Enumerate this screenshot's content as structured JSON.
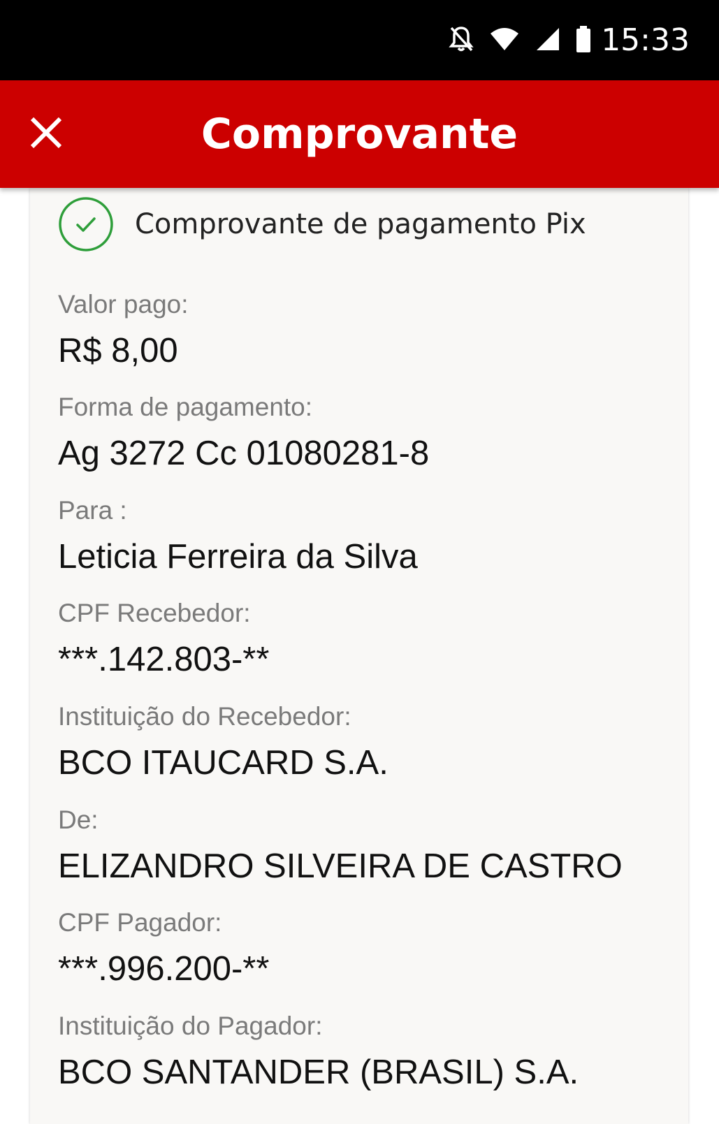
{
  "status_bar": {
    "time": "15:33",
    "icons": [
      "bell-off-icon",
      "wifi-icon",
      "cell-signal-icon",
      "battery-icon"
    ]
  },
  "app_bar": {
    "title": "Comprovante",
    "close_icon": "close-icon",
    "color": "#cc0000"
  },
  "receipt": {
    "header": "Comprovante de pagamento Pix",
    "success_color": "#2e9e3a",
    "fields": [
      {
        "label": "Valor pago:",
        "value": "R$ 8,00"
      },
      {
        "label": "Forma de pagamento:",
        "value": "Ag 3272 Cc 01080281-8"
      },
      {
        "label": "Para :",
        "value": "Leticia Ferreira da Silva"
      },
      {
        "label": "CPF Recebedor:",
        "value": "***.142.803-**"
      },
      {
        "label": "Instituição do Recebedor:",
        "value": "BCO ITAUCARD S.A."
      },
      {
        "label": "De:",
        "value": "ELIZANDRO SILVEIRA DE CASTRO"
      },
      {
        "label": "CPF Pagador:",
        "value": "***.996.200-**"
      },
      {
        "label": "Instituição do Pagador:",
        "value": "BCO SANTANDER (BRASIL) S.A."
      }
    ]
  }
}
